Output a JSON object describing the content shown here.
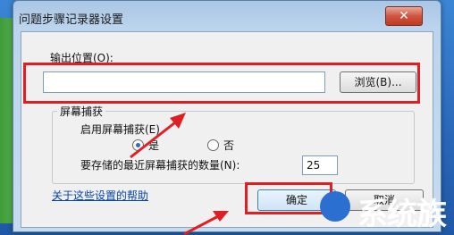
{
  "window": {
    "title": "问题步骤记录器设置",
    "close_label": "✕"
  },
  "output": {
    "label": "输出位置(O):",
    "value": "",
    "browse_label": "浏览(B)..."
  },
  "capture": {
    "group_title": "屏幕捕获",
    "enable_label": "启用屏幕捕获(E)",
    "yes_label": "是",
    "no_label": "否",
    "selected": "是",
    "count_label": "要存储的最近屏幕捕获的数量(N):",
    "count_value": "25"
  },
  "footer": {
    "help_link": "关于这些设置的帮助",
    "ok_label": "确定",
    "cancel_label": "取消"
  },
  "watermark": {
    "text": "系统族"
  },
  "colors": {
    "highlight": "#e01f24",
    "arrow": "#e01f24"
  }
}
